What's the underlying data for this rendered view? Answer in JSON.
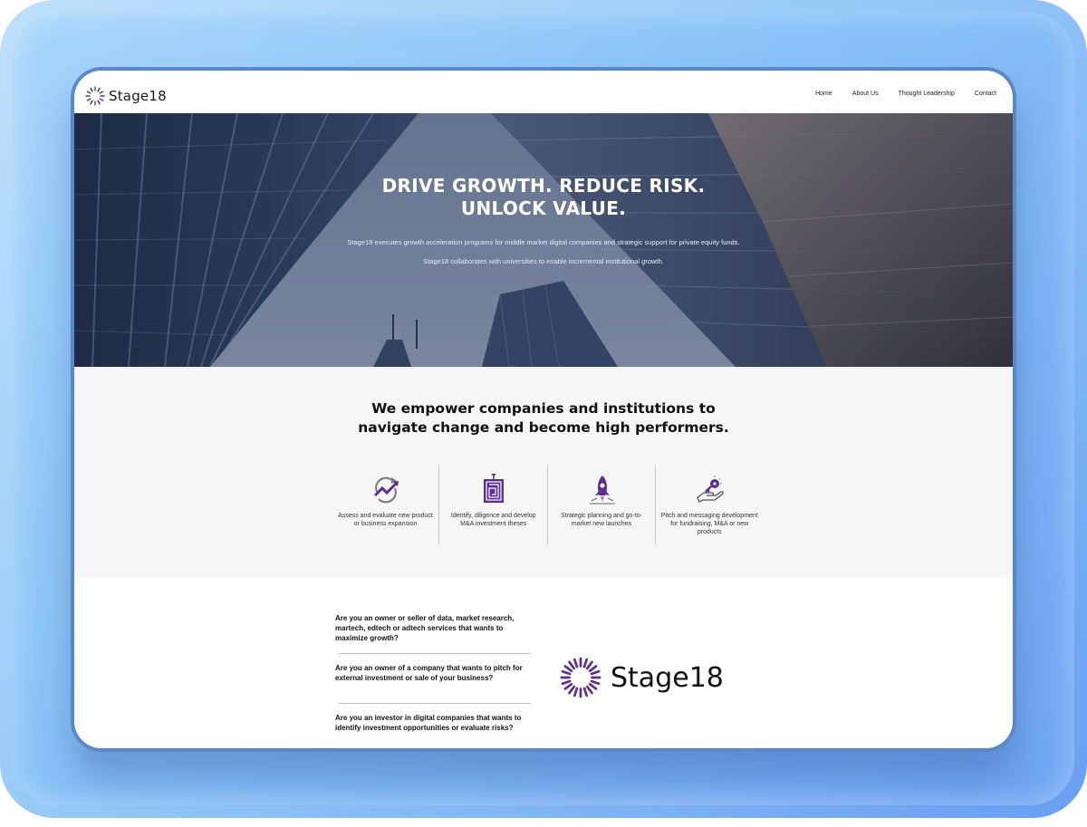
{
  "brand": {
    "name": "Stage18",
    "accent_color": "#5b2d8e"
  },
  "nav": {
    "items": [
      "Home",
      "About Us",
      "Thought Leadership",
      "Contact"
    ]
  },
  "hero": {
    "title_line1": "DRIVE GROWTH. REDUCE RISK.",
    "title_line2": "UNLOCK VALUE.",
    "subtitle1": "Stage18 executes growth acceleration programs for middle market digital companies and strategic support for private equity funds.",
    "subtitle2": "Stage18 collaborates with universities to enable incremental institutional growth."
  },
  "empower": {
    "title_line1": "We empower companies and institutions to",
    "title_line2": "navigate change and become high performers.",
    "features": [
      {
        "icon": "growth-arrows-icon",
        "text": "Assess and evaluate new product or business expansion"
      },
      {
        "icon": "maze-icon",
        "text": "Identify, diligence and develop M&A investment theses"
      },
      {
        "icon": "rocket-icon",
        "text": "Strategic planning and go-to-market new launches"
      },
      {
        "icon": "hand-key-icon",
        "text": "Pitch and messaging development for fundraising, M&A or new products"
      }
    ]
  },
  "faq": {
    "questions": [
      "Are you an owner or seller of data, market research, martech, edtech or adtech services that wants to maximize growth?",
      "Are you an owner of a company that wants to pitch for external investment or sale of your business?",
      "Are you an investor in digital companies that wants to identify investment opportunities or evaluate risks?"
    ]
  }
}
